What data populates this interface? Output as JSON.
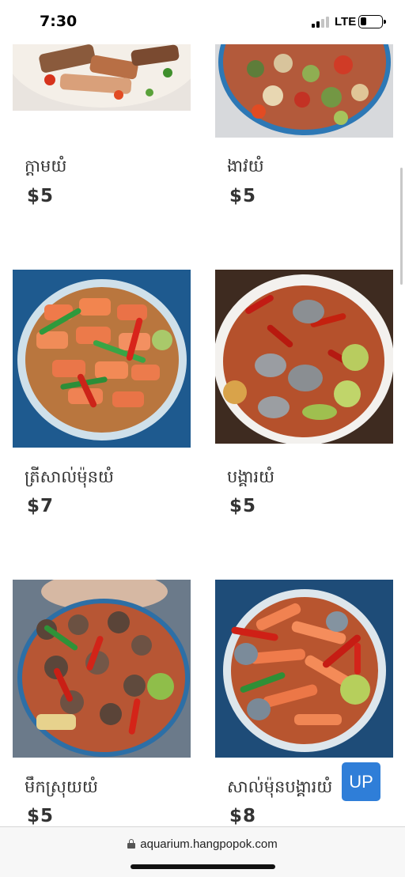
{
  "status_bar": {
    "time": "7:30",
    "network": "LTE",
    "signal_icon": "signal-bars-icon",
    "battery_icon": "battery-icon"
  },
  "menu_items": [
    {
      "name": "ក្តាមយំ",
      "price": "$5",
      "image": "crab-salad"
    },
    {
      "name": "ងាវយំ",
      "price": "$5",
      "image": "cockle-salad"
    },
    {
      "name": "ត្រីសាល់ម៉ុនយំ",
      "price": "$7",
      "image": "salmon-salad"
    },
    {
      "name": "បង្គារយំ",
      "price": "$5",
      "image": "shrimp-salad"
    },
    {
      "name": "មឹកស្រុយយំ",
      "price": "$5",
      "image": "octopus-salad"
    },
    {
      "name": "សាល់ម៉ុនបង្គារយំ",
      "price": "$8",
      "image": "salmon-shrimp-salad"
    }
  ],
  "up_button": {
    "label": "UP",
    "color": "#2f7ed8"
  },
  "url_bar": {
    "url": "aquarium.hangpopok.com",
    "icon": "lock-icon"
  }
}
